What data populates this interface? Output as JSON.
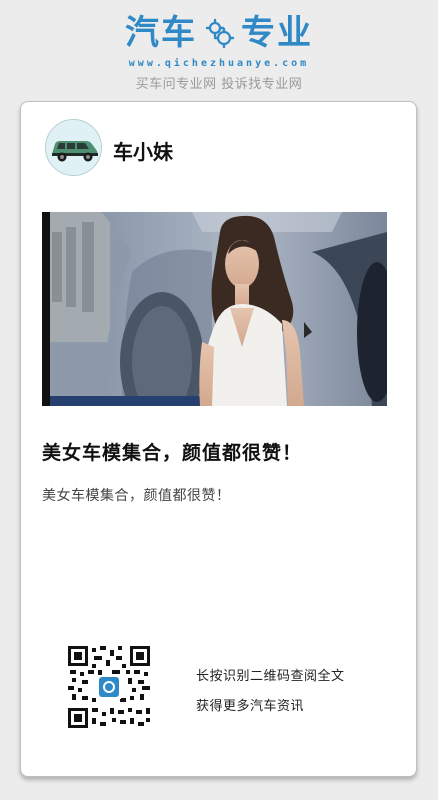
{
  "header": {
    "logo_left": "汽车",
    "logo_right": "专业",
    "logo_icon": "gear-icon",
    "url": "www.qichezhuanye.com",
    "slogan": "买车问专业网 投诉找专业网",
    "brand_color": "#2f89c6"
  },
  "card": {
    "author_name": "车小妹",
    "avatar_icon": "car-icon",
    "article_title": "美女车模集合，颜值都很赞！",
    "article_summary": "美女车模集合，颜值都很赞！",
    "qr_icon": "qr-code-icon",
    "qr_line1": "长按识别二维码查阅全文",
    "qr_line2": "获得更多汽车资讯"
  }
}
